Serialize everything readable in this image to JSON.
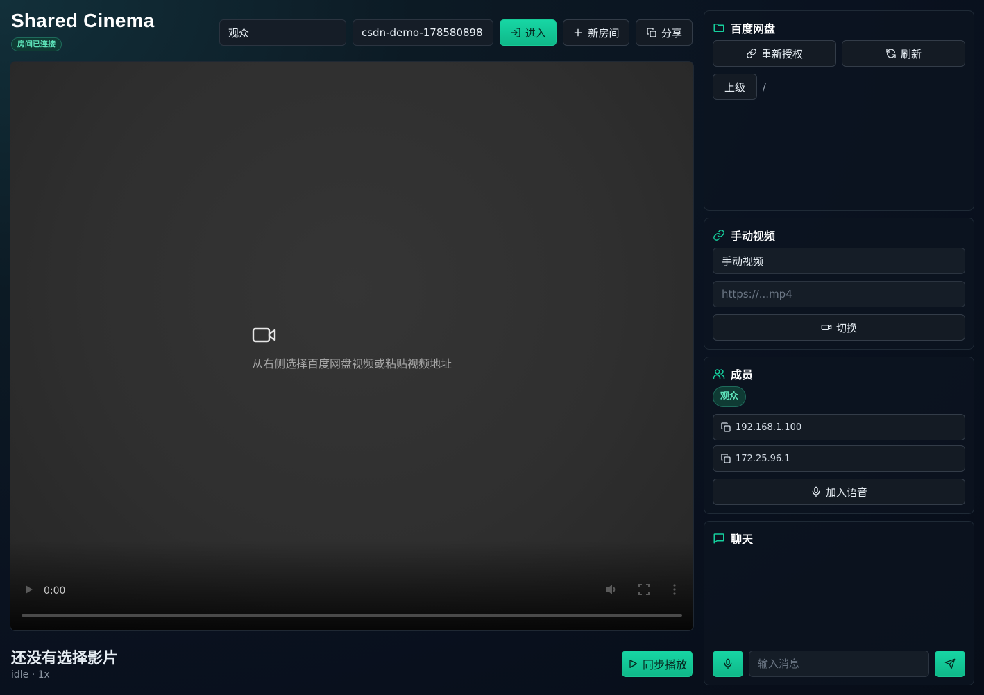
{
  "header": {
    "title": "Shared Cinema",
    "status": "房间已连接",
    "name_value": "观众",
    "room_value": "csdn-demo-178580898",
    "enter_label": "进入",
    "new_room_label": "新房间",
    "share_label": "分享"
  },
  "player": {
    "placeholder": "从右侧选择百度网盘视频或粘贴视频地址",
    "time": "0:00",
    "progress": 0
  },
  "now_playing": {
    "title": "还没有选择影片",
    "status": "idle · 1x",
    "sync_label": "同步播放"
  },
  "baidu": {
    "title": "百度网盘",
    "reauth_label": "重新授权",
    "refresh_label": "刷新",
    "up_label": "上级",
    "path": "/"
  },
  "manual": {
    "title": "手动视频",
    "title_value": "手动视频",
    "url_placeholder": "https://...mp4",
    "switch_label": "切换"
  },
  "members": {
    "title": "成员",
    "role": "观众",
    "ips": [
      "192.168.1.100",
      "172.25.96.1"
    ],
    "voice_label": "加入语音"
  },
  "chat": {
    "title": "聊天",
    "input_placeholder": "输入消息"
  },
  "colors": {
    "accent": "#15cf9d",
    "background": "#0a1220",
    "panel_border": "#1f2a36"
  }
}
